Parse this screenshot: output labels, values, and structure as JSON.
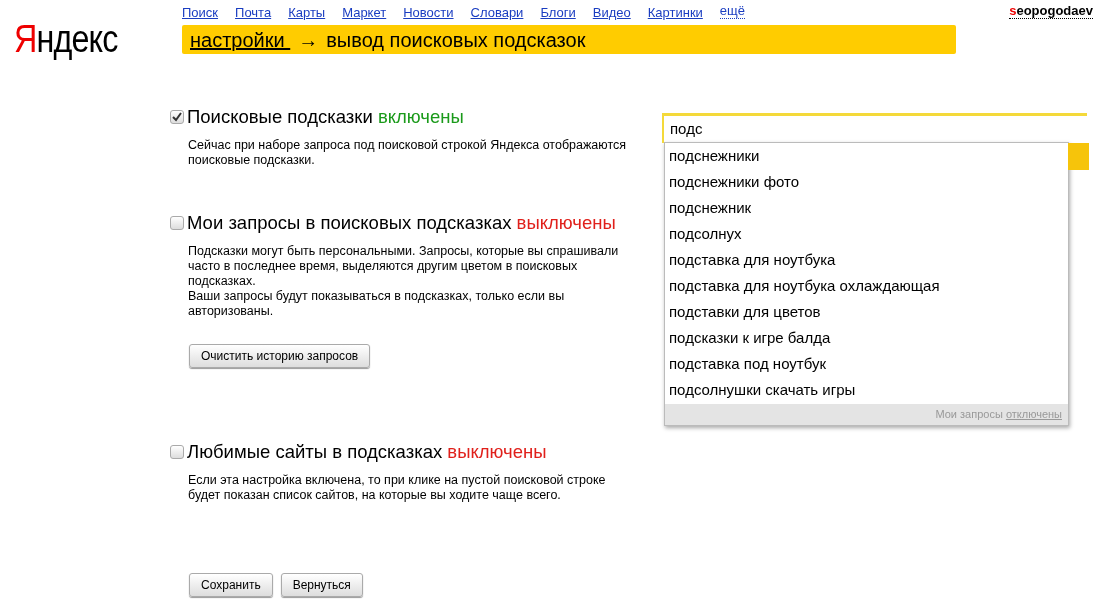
{
  "logo": {
    "first": "Я",
    "rest": "ндекс"
  },
  "nav": [
    {
      "label": "Поиск",
      "kind": "link"
    },
    {
      "label": "Почта",
      "kind": "link"
    },
    {
      "label": "Карты",
      "kind": "link"
    },
    {
      "label": "Маркет",
      "kind": "link"
    },
    {
      "label": "Новости",
      "kind": "link"
    },
    {
      "label": "Словари",
      "kind": "link"
    },
    {
      "label": "Блоги",
      "kind": "link"
    },
    {
      "label": "Видео",
      "kind": "link"
    },
    {
      "label": "Картинки",
      "kind": "link"
    },
    {
      "label": "ещё",
      "kind": "more"
    }
  ],
  "user": {
    "first": "s",
    "rest": "eopogodaev"
  },
  "breadcrumb": {
    "link": "настройки ",
    "arrow": "→",
    "title": "вывод поисковых подсказок"
  },
  "settings": [
    {
      "checked": true,
      "label": "Поисковые подсказки",
      "state_text": "включены",
      "paragraphs": [
        "Сейчас при наборе запроса под поисковой строкой Яндекса отображаются поисковые подсказки."
      ]
    },
    {
      "checked": false,
      "label": "Мои запросы в поисковых подсказках",
      "state_text": "выключены",
      "paragraphs": [
        "Подсказки могут быть персональными. Запросы, которые вы спрашивали часто в последнее время, выделяются другим цветом в поисковых подсказках.",
        "Ваши запросы будут показываться в подсказках, только если вы авторизованы."
      ],
      "button": "Очистить историю запросов"
    },
    {
      "checked": false,
      "label": "Любимые сайты в подсказках",
      "state_text": "выключены",
      "paragraphs": [
        "Если эта настройка включена, то при клике на пустой поисковой строке будет показан список сайтов, на которые вы ходите чаще всего."
      ]
    }
  ],
  "actions": [
    "Сохранить",
    "Вернуться"
  ],
  "preview": {
    "query": "подс",
    "suggestions": [
      "подснежники",
      "подснежники фото",
      "подснежник",
      "подсолнух",
      "подставка для ноутбука",
      "подставка для ноутбука охлаждающая",
      "подставки для цветов",
      "подсказки к игре балда",
      "подставка под ноутбук",
      "подсолнушки скачать игры"
    ],
    "footer_text": "Мои запросы",
    "footer_link": "отключены"
  }
}
